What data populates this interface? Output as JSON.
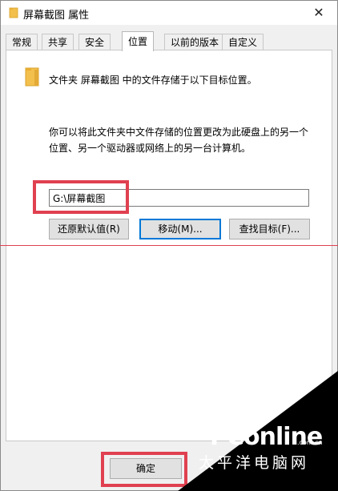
{
  "window": {
    "title": "屏幕截图 属性",
    "close_glyph": "✕"
  },
  "tabs": [
    {
      "label": "常规",
      "active": false
    },
    {
      "label": "共享",
      "active": false
    },
    {
      "label": "安全",
      "active": false
    },
    {
      "label": "位置",
      "active": true
    },
    {
      "label": "以前的版本",
      "active": false
    },
    {
      "label": "自定义",
      "active": false
    }
  ],
  "location": {
    "info": "文件夹 屏幕截图 中的文件存储于以下目标位置。",
    "desc_line1": "你可以将此文件夹中文件存储的位置更改为此硬盘上的另一个",
    "desc_line2": "位置、另一个驱动器或网络上的另一台计算机。",
    "path_value": "G:\\屏幕截图",
    "restore_button": "还原默认值(R)",
    "move_button": "移动(M)...",
    "find_button": "查找目标(F)..."
  },
  "footer": {
    "ok_button": "确定"
  },
  "watermark": {
    "brand": "PConline",
    "domain": ".com.cn",
    "chinese": "太平洋电脑网"
  },
  "colors": {
    "highlight": "#e04050",
    "focus": "#0078d7",
    "folder": "#f3c04d"
  },
  "icons": {
    "title": "folder-icon",
    "panel": "folder-icon",
    "close": "close-icon"
  }
}
